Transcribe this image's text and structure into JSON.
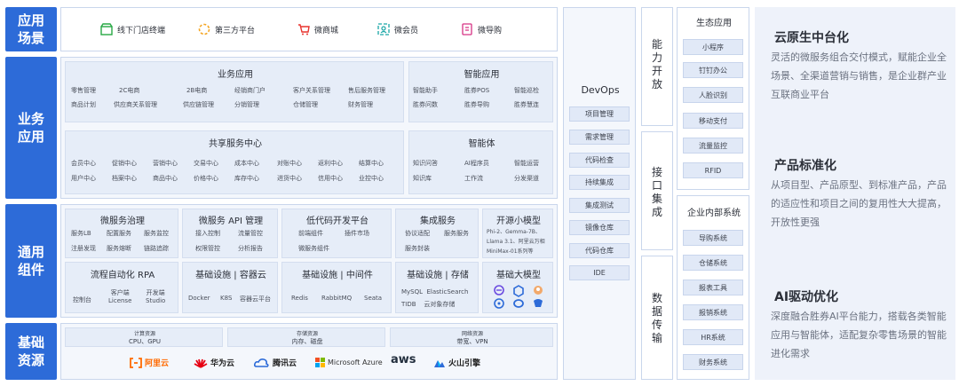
{
  "left_labels": {
    "scene": "应用场景",
    "business": "业务应用",
    "common": "通用组件",
    "infra": "基础资源"
  },
  "scenes": [
    "线下门店终端",
    "第三方平台",
    "微商城",
    "微会员",
    "微导购"
  ],
  "biz_app": {
    "title": "业务应用",
    "row1": [
      "零售管理",
      "2C电商",
      "2B电商",
      "经销商门户",
      "客户关系管理",
      "售后服务管理"
    ],
    "row2": [
      "商品计划",
      "供应商关系管理",
      "供应链管理",
      "分销管理",
      "仓储管理",
      "财务管理"
    ]
  },
  "smart_app": {
    "title": "智能应用",
    "row1": [
      "智能助手",
      "胜券POS",
      "智能巡检"
    ],
    "row2": [
      "胜券问数",
      "胜券导购",
      "胜券慧连"
    ]
  },
  "shared": {
    "title": "共享服务中心",
    "row1": [
      "会员中心",
      "促销中心",
      "营销中心",
      "交易中心",
      "成本中心",
      "对账中心",
      "返利中心",
      "结算中心"
    ],
    "row2": [
      "用户中心",
      "档案中心",
      "商品中心",
      "价格中心",
      "库存中心",
      "进货中心",
      "信用中心",
      "业控中心"
    ]
  },
  "agent": {
    "title": "智能体",
    "row1": [
      "知识问答",
      "AI程序员",
      "智能运营"
    ],
    "row2": [
      "知识库",
      "工作流",
      "分发渠道"
    ]
  },
  "common_top": [
    {
      "title": "微服务治理",
      "row1": [
        "服务LB",
        "配置服务",
        "服务监控"
      ],
      "row2": [
        "注册发现",
        "服务熔断",
        "链路追踪"
      ]
    },
    {
      "title": "微服务 API 管理",
      "row1": [
        "接入控制",
        "流量管控"
      ],
      "row2": [
        "权限管控",
        "分析报告"
      ]
    },
    {
      "title": "低代码开发平台",
      "row1": [
        "前端组件",
        "插件市场"
      ],
      "row2": [
        "微服务组件"
      ]
    },
    {
      "title": "集成服务",
      "row1": [
        "协议适配",
        "服务服务"
      ],
      "row2": [
        "服务封装"
      ]
    },
    {
      "title": "开源小模型",
      "row1": [
        "Phi-2、Gemma-7B、"
      ],
      "row2": [
        "Llama 3.1、阿里云万相"
      ],
      "row3": [
        "MiniMax-01系列等"
      ]
    }
  ],
  "common_bottom": [
    {
      "title": "流程自动化 RPA",
      "items": [
        "控制台",
        "客户端\nLicense",
        "开发端\nStudio"
      ]
    },
    {
      "title": "基础设施 | 容器云",
      "items": [
        "Docker",
        "K8S",
        "容器云平台"
      ]
    },
    {
      "title": "基础设施 | 中间件",
      "items": [
        "Redis",
        "RabbitMQ",
        "Seata"
      ]
    },
    {
      "title": "基础设施 | 存储",
      "items": [
        "MySQL  ElasticSearch",
        "TIDB    云对象存储"
      ]
    },
    {
      "title": "基础大模型",
      "items": []
    }
  ],
  "resources": [
    {
      "title": "计算资源",
      "sub": "CPU、GPU"
    },
    {
      "title": "存储资源",
      "sub": "内存、磁盘"
    },
    {
      "title": "网络资源",
      "sub": "带宽、VPN"
    }
  ],
  "clouds": [
    "阿里云",
    "华为云",
    "腾讯云",
    "Microsoft Azure",
    "aws",
    "火山引擎"
  ],
  "devops": {
    "title": "DevOps",
    "items": [
      "项目管理",
      "需求管理",
      "代码检查",
      "持续集成",
      "集成测试",
      "镜像仓库",
      "代码仓库",
      "IDE"
    ]
  },
  "vertical": {
    "open": "能力开放",
    "integration": "接口集成",
    "transfer": "数据传输"
  },
  "eco": {
    "title": "生态应用",
    "items": [
      "小程序",
      "钉钉办公",
      "人脸识别",
      "移动支付",
      "流量监控",
      "RFID"
    ]
  },
  "internal": {
    "title": "企业内部系统",
    "items": [
      "导购系统",
      "仓储系统",
      "报表工具",
      "报销系统",
      "HR系统",
      "财务系统"
    ]
  },
  "features": [
    {
      "title": "云原生中台化",
      "desc": "灵活的微服务组合交付模式，赋能企业全场景、全渠道营销与销售，是企业群产业互联商业平台"
    },
    {
      "title": "产品标准化",
      "desc": "从项目型、产品原型、到标准产品，产品的适应性和项目之间的复用性大大提高，开放性更强"
    },
    {
      "title": "AI驱动优化",
      "desc": "深度融合胜券AI平台能力，搭载各类智能应用与智能体，适配复杂零售场景的智能进化需求"
    }
  ],
  "colors": {
    "brand_blue": "#2d6bd8",
    "panel": "#f4f7fc",
    "chip": "#e1e9f7",
    "right_bg": "#eef2fa"
  }
}
